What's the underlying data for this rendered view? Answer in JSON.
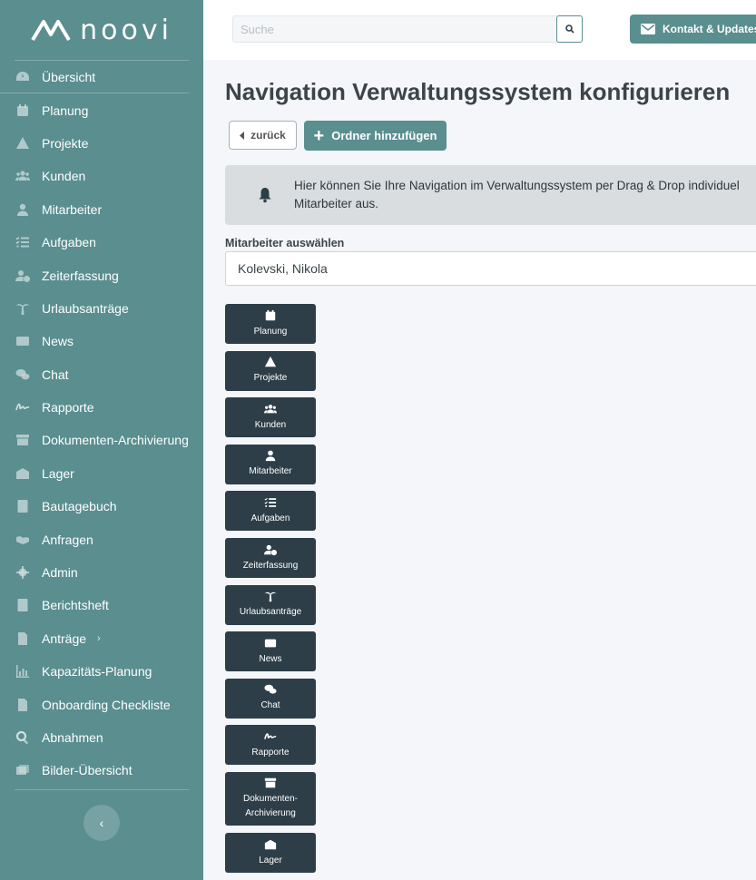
{
  "brand": {
    "name": "noovi"
  },
  "sidebar": {
    "items": [
      {
        "label": "Übersicht",
        "icon": "dashboard-icon"
      },
      {
        "label": "Planung",
        "icon": "calendar-icon"
      },
      {
        "label": "Projekte",
        "icon": "warning-tools-icon"
      },
      {
        "label": "Kunden",
        "icon": "users-icon"
      },
      {
        "label": "Mitarbeiter",
        "icon": "user-icon"
      },
      {
        "label": "Aufgaben",
        "icon": "tasks-icon"
      },
      {
        "label": "Zeiterfassung",
        "icon": "user-clock-icon"
      },
      {
        "label": "Urlaubsanträge",
        "icon": "palm-tree-icon"
      },
      {
        "label": "News",
        "icon": "newspaper-icon"
      },
      {
        "label": "Chat",
        "icon": "chat-icon"
      },
      {
        "label": "Rapporte",
        "icon": "signature-icon"
      },
      {
        "label": "Dokumenten-Archivierung",
        "icon": "archive-icon"
      },
      {
        "label": "Lager",
        "icon": "warehouse-icon"
      },
      {
        "label": "Bautagebuch",
        "icon": "book-icon"
      },
      {
        "label": "Anfragen",
        "icon": "handshake-icon"
      },
      {
        "label": "Admin",
        "icon": "gear-icon"
      },
      {
        "label": "Berichtsheft",
        "icon": "notebook-icon"
      },
      {
        "label": "Anträge",
        "icon": "file-check-icon",
        "has_submenu": true
      },
      {
        "label": "Kapazitäts-Planung",
        "icon": "chart-icon"
      },
      {
        "label": "Onboarding Checkliste",
        "icon": "document-icon"
      },
      {
        "label": "Abnahmen",
        "icon": "search-icon"
      },
      {
        "label": "Bilder-Übersicht",
        "icon": "images-icon"
      }
    ],
    "collapse_glyph": "‹"
  },
  "topbar": {
    "search_placeholder": "Suche",
    "contact_label": "Kontakt & Updates"
  },
  "main": {
    "title": "Navigation Verwaltungssystem konfigurieren",
    "back_label": "zurück",
    "add_folder_label": "Ordner hinzufügen",
    "info_line1": "Hier können Sie Ihre Navigation im Verwaltungssystem per Drag & Drop individuel",
    "info_line2": "Mitarbeiter aus.",
    "employee_label": "Mitarbeiter auswählen",
    "employee_value": "Kolevski, Nikola",
    "tiles": [
      {
        "label": "Planung",
        "icon": "calendar-icon"
      },
      {
        "label": "Projekte",
        "icon": "warning-tools-icon"
      },
      {
        "label": "Kunden",
        "icon": "users-icon"
      },
      {
        "label": "Mitarbeiter",
        "icon": "user-icon"
      },
      {
        "label": "Aufgaben",
        "icon": "tasks-icon"
      },
      {
        "label": "Zeiterfassung",
        "icon": "user-clock-icon"
      },
      {
        "label": "Urlaubsanträge",
        "icon": "palm-tree-icon"
      },
      {
        "label": "News",
        "icon": "newspaper-icon"
      },
      {
        "label": "Chat",
        "icon": "chat-icon"
      },
      {
        "label": "Rapporte",
        "icon": "signature-icon"
      },
      {
        "label": "Dokumenten-Archivierung",
        "icon": "archive-icon"
      },
      {
        "label": "Lager",
        "icon": "warehouse-icon"
      }
    ]
  },
  "colors": {
    "sidebar": "#5a8e8f",
    "accent": "#5a8e8f",
    "tile": "#2d3e48",
    "info_bg": "#d9dde0",
    "page_bg": "#f4f6f9"
  }
}
